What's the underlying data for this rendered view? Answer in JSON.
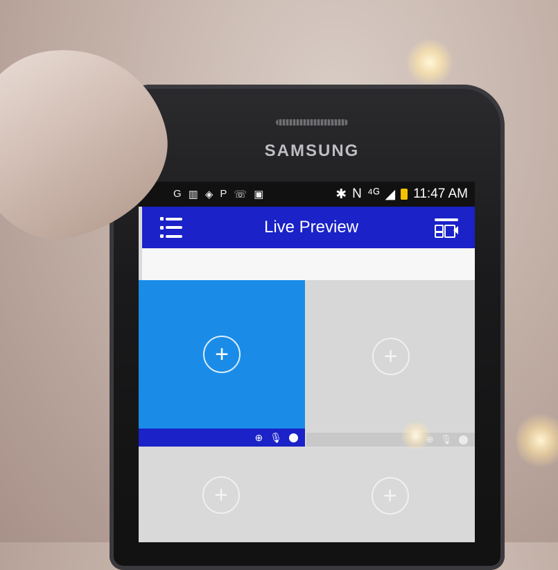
{
  "phone": {
    "brand": "SAMSUNG"
  },
  "status_bar": {
    "time": "11:47 AM",
    "left_icons": [
      "G",
      "▥",
      "◈",
      "P",
      "☏",
      "▣"
    ],
    "right_icons": [
      "✱",
      "N",
      "⁴ᴳ",
      "◢"
    ]
  },
  "app": {
    "title": "Live Preview",
    "menu_icon": "list-menu-icon",
    "camera_icon": "camera-list-icon"
  },
  "tiles": [
    {
      "selected": true,
      "plus": "+"
    },
    {
      "selected": false,
      "plus": "+"
    },
    {
      "selected": false,
      "plus": "+"
    },
    {
      "selected": false,
      "plus": "+"
    }
  ],
  "tile_controls": {
    "zoom": "⊕",
    "mic": "🎙"
  },
  "colors": {
    "app_bar": "#1a22c8",
    "selected_tile": "#1a8ce8",
    "empty_tile": "#d7d7d7"
  }
}
